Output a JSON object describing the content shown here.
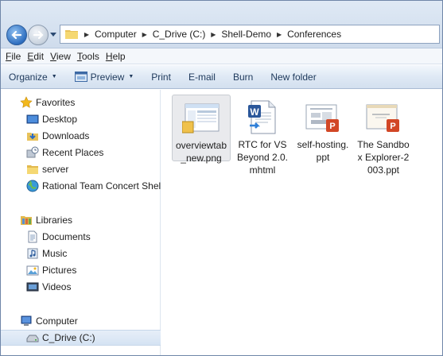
{
  "address": {
    "crumbs": [
      "Computer",
      "C_Drive (C:)",
      "Shell-Demo",
      "Conferences"
    ]
  },
  "menubar": {
    "items": [
      {
        "first": "F",
        "rest": "ile"
      },
      {
        "first": "E",
        "rest": "dit"
      },
      {
        "first": "V",
        "rest": "iew"
      },
      {
        "first": "T",
        "rest": "ools"
      },
      {
        "first": "H",
        "rest": "elp"
      }
    ]
  },
  "toolbar": {
    "organize": "Organize",
    "preview": "Preview",
    "print": "Print",
    "email": "E-mail",
    "burn": "Burn",
    "new_folder": "New folder"
  },
  "navpane": {
    "favorites": "Favorites",
    "desktop": "Desktop",
    "downloads": "Downloads",
    "recent_places": "Recent Places",
    "server": "server",
    "rational": "Rational Team Concert Shell",
    "libraries": "Libraries",
    "documents": "Documents",
    "music": "Music",
    "pictures": "Pictures",
    "videos": "Videos",
    "computer": "Computer",
    "c_drive": "C_Drive (C:)"
  },
  "files": [
    {
      "name": "overviewtab_new.png",
      "icon": "png-image-icon"
    },
    {
      "name": "RTC for VS Beyond 2.0.mhtml",
      "icon": "word-document-icon"
    },
    {
      "name": "self-hosting.ppt",
      "icon": "powerpoint-icon"
    },
    {
      "name": "The Sandbox Explorer-2003.ppt",
      "icon": "powerpoint-icon"
    }
  ]
}
